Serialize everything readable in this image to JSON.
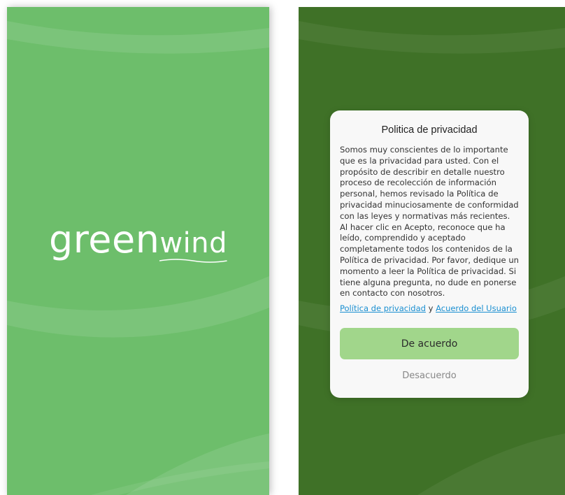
{
  "splash": {
    "logo_part1": "green",
    "logo_part2": "wind",
    "background_color": "#6dbe6b"
  },
  "privacy_dialog": {
    "title": "Politica de privacidad",
    "body": "Somos muy conscientes de lo importante que es la privacidad para usted. Con el propósito de describir en detalle nuestro proceso de recolección de información personal, hemos revisado la Política de privacidad minuciosamente de conformidad con las leyes y normativas más recientes. Al hacer clic en Acepto, reconoce que ha leído, comprendido y aceptado completamente todos los contenidos de la Política de privacidad. Por favor, dedique un momento a leer la Política de privacidad. Si tiene alguna pregunta, no dude en ponerse en contacto con nosotros.",
    "link_privacy": "Política de privacidad",
    "link_separator": "y",
    "link_user_agreement": "Acuerdo del Usuario",
    "agree_label": "De acuerdo",
    "disagree_label": "Desacuerdo",
    "overlay_color": "#3f7127",
    "agree_color": "#a1d68b",
    "link_color": "#1a8fd1"
  }
}
